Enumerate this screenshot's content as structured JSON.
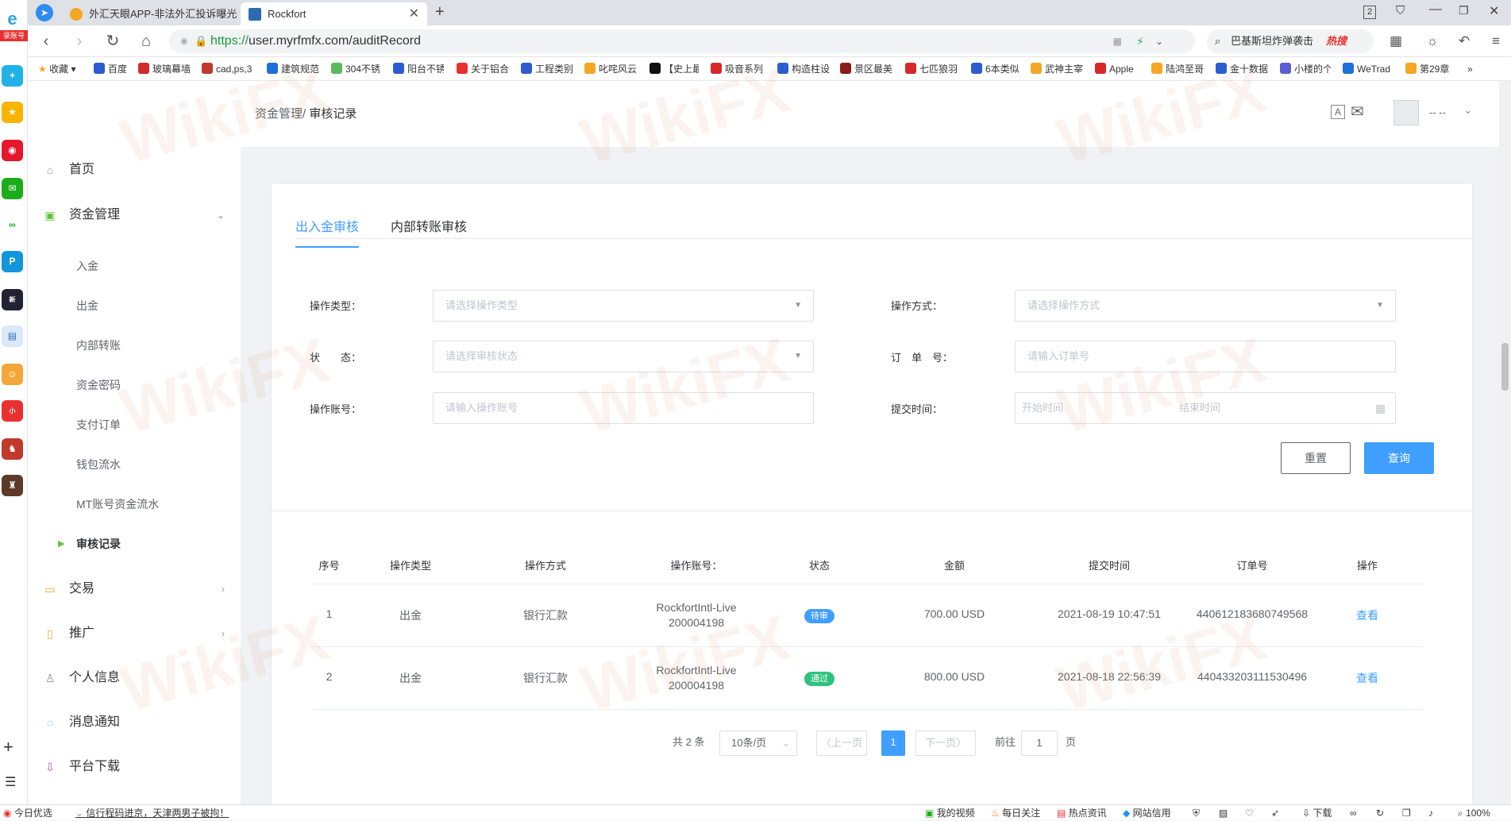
{
  "browser": {
    "tabs": [
      {
        "title": "外汇天眼APP-非法外汇投诉曝光"
      },
      {
        "title": "Rockfort"
      }
    ],
    "tab_count": "2",
    "url_scheme": "https://",
    "url_rest": "user.myrfmfx.com/auditRecord",
    "search_text": "巴基斯坦炸弹袭击",
    "search_hot": "热搜",
    "bookmarks": [
      "收藏",
      "百度",
      "玻璃幕墙",
      "cad,ps,3",
      "建筑规范",
      "304不锈",
      "阳台不锈",
      "关于铝合",
      "工程类别",
      "叱咤风云",
      "【史上最",
      "吸音系列",
      "构造柱设",
      "景区最美",
      "七匹狼羽",
      "6本类似",
      "武神主宰",
      "Apple",
      "陆鸿至哥",
      "金十数据",
      "小楼的个",
      "WeTrad",
      "第29章"
    ],
    "bookmarks_more": "»"
  },
  "left_strip": {
    "label": "录账号",
    "add": "+",
    "menu": "☰"
  },
  "sidebar": {
    "items": [
      {
        "label": "首页",
        "icon": "home-icon"
      },
      {
        "label": "资金管理",
        "icon": "wallet-icon",
        "arrow": "⌄"
      },
      {
        "label": "交易",
        "icon": "chart-icon",
        "arrow": "›"
      },
      {
        "label": "推广",
        "icon": "book-icon",
        "arrow": "›"
      },
      {
        "label": "个人信息",
        "icon": "user-icon"
      },
      {
        "label": "消息通知",
        "icon": "message-icon"
      },
      {
        "label": "平台下载",
        "icon": "download-icon"
      }
    ],
    "sub_items": [
      "入金",
      "出金",
      "内部转账",
      "资金密码",
      "支付订单",
      "钱包流水",
      "MT账号资金流水",
      "审核记录"
    ],
    "active_marker": "▶"
  },
  "header": {
    "breadcrumb_parent": "资金管理/",
    "breadcrumb_current": "审核记录",
    "user_name": "-- --",
    "user_caret": "⌄"
  },
  "tabs": {
    "inout": "出入金审核",
    "internal": "内部转账审核"
  },
  "filters": {
    "op_type_label": "操作类型：",
    "op_type_placeholder": "请选择操作类型",
    "op_method_label": "操作方式：",
    "op_method_placeholder": "请选择操作方式",
    "status_label": "状　　态：",
    "status_placeholder": "请选择审核状态",
    "order_label": "订　单　号：",
    "order_placeholder": "请输入订单号",
    "account_label": "操作账号：",
    "account_placeholder": "请输入操作账号",
    "time_label": "提交时间：",
    "start_placeholder": "开始时间",
    "end_placeholder": "结束时间",
    "caret": "▼",
    "reset": "重置",
    "query": "查询"
  },
  "table": {
    "headers": [
      "序号",
      "操作类型",
      "操作方式",
      "操作账号：",
      "状态",
      "金额",
      "提交时间",
      "订单号",
      "操作"
    ],
    "rows": [
      {
        "index": "1",
        "type": "出金",
        "method": "银行汇款",
        "account_l1": "RockfortIntl-Live",
        "account_l2": "200004198",
        "status": "待审",
        "status_color": "#409eff",
        "amount": "700.00 USD",
        "time": "2021-08-19 10:47:51",
        "order": "440612183680749568",
        "action": "查看"
      },
      {
        "index": "2",
        "type": "出金",
        "method": "银行汇款",
        "account_l1": "RockfortIntl-Live",
        "account_l2": "200004198",
        "status": "通过",
        "status_color": "#2ec27e",
        "amount": "800.00 USD",
        "time": "2021-08-18 22:56:39",
        "order": "440433203111530496",
        "action": "查看"
      }
    ]
  },
  "pagination": {
    "total": "共 2 条",
    "page_size": "10条/页",
    "size_caret": "⌄",
    "prev": "〈上一页",
    "current": "1",
    "next": "下一页〉",
    "goto_label": "前往",
    "goto_value": "1",
    "page_suffix": "页"
  },
  "statusbar": {
    "today": "今日优选",
    "news": "信行程码进京，天津两男子被拘！",
    "items": [
      "我的视频",
      "每日关注",
      "热点资讯",
      "网站信用",
      "下载",
      "100%"
    ]
  },
  "watermark": "WikiFX",
  "colors": {
    "accent": "#409eff",
    "pending": "#409eff",
    "passed": "#2ec27e",
    "active_marker": "#67c23a"
  }
}
